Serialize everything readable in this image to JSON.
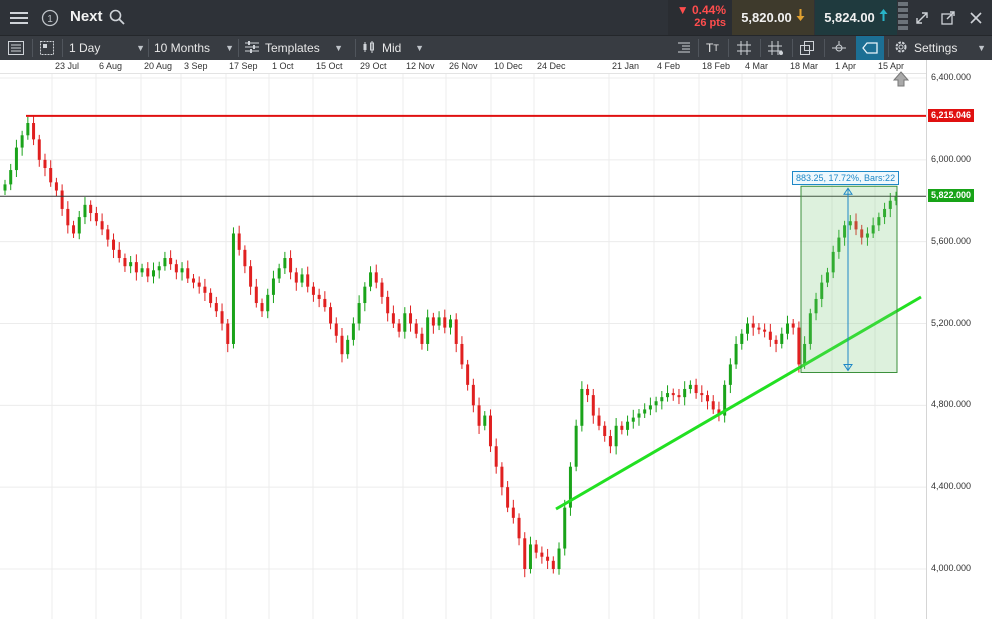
{
  "header": {
    "instrument": "Next",
    "change_pct": "0.44%",
    "change_pts": "26 pts",
    "sell_price": "5,820.00",
    "buy_price": "5,824.00",
    "icons": [
      "menu-icon",
      "history-icon",
      "search-icon",
      "sell-down-arrow-icon",
      "buy-up-arrow-icon",
      "expand-icon",
      "popout-icon",
      "close-icon"
    ]
  },
  "toolbar": {
    "interval": "1 Day",
    "range": "10 Months",
    "templates": "Templates",
    "price_type": "Mid",
    "settings": "Settings"
  },
  "chart_data": {
    "type": "candlestick",
    "x_labels": [
      "23 Jul",
      "6 Aug",
      "20 Aug",
      "3 Sep",
      "17 Sep",
      "1 Oct",
      "15 Oct",
      "29 Oct",
      "12 Nov",
      "26 Nov",
      "10 Dec",
      "24 Dec",
      "21 Jan",
      "4 Feb",
      "18 Feb",
      "4 Mar",
      "18 Mar",
      "1 Apr",
      "15 Apr"
    ],
    "y_ticks": [
      "6,400.000",
      "6,000.000",
      "5,600.000",
      "5,200.000",
      "4,800.000",
      "4,400.000",
      "4,000.000"
    ],
    "ylim": [
      3980,
      6400
    ],
    "horizontal_line": {
      "value": 6215.046,
      "label": "6,215.046",
      "color": "#e01010"
    },
    "current_price": {
      "value": 5822.0,
      "label": "5,822.000",
      "color": "#17a317"
    },
    "trendline": {
      "color": "#22e022"
    },
    "measure": {
      "label": "883.25, 17.72%, Bars:22",
      "from": 4980,
      "to": 5822
    },
    "up_color": "#1aa31a",
    "down_color": "#e02020",
    "closes": [
      5880,
      5950,
      6060,
      6120,
      6180,
      6100,
      6000,
      5960,
      5890,
      5850,
      5760,
      5680,
      5640,
      5720,
      5780,
      5740,
      5700,
      5660,
      5610,
      5560,
      5520,
      5480,
      5500,
      5450,
      5470,
      5430,
      5460,
      5480,
      5520,
      5490,
      5450,
      5470,
      5420,
      5400,
      5380,
      5350,
      5300,
      5260,
      5200,
      5100,
      5640,
      5560,
      5480,
      5380,
      5300,
      5260,
      5340,
      5420,
      5470,
      5520,
      5450,
      5400,
      5440,
      5380,
      5340,
      5320,
      5280,
      5200,
      5140,
      5050,
      5120,
      5200,
      5300,
      5380,
      5450,
      5400,
      5330,
      5250,
      5200,
      5160,
      5250,
      5200,
      5150,
      5100,
      5230,
      5190,
      5230,
      5180,
      5220,
      5100,
      5000,
      4900,
      4800,
      4700,
      4750,
      4600,
      4500,
      4400,
      4300,
      4250,
      4150,
      4000,
      4120,
      4080,
      4060,
      4040,
      4000,
      4100,
      4300,
      4500,
      4700,
      4880,
      4850,
      4750,
      4700,
      4650,
      4600,
      4700,
      4680,
      4720,
      4740,
      4760,
      4780,
      4800,
      4820,
      4840,
      4860,
      4850,
      4840,
      4880,
      4900,
      4860,
      4850,
      4820,
      4780,
      4750,
      4900,
      5000,
      5100,
      5150,
      5200,
      5180,
      5170,
      5160,
      5120,
      5100,
      5150,
      5200,
      5180,
      5000,
      5100,
      5250,
      5320,
      5400,
      5450,
      5550,
      5620,
      5680,
      5700,
      5660,
      5620,
      5640,
      5680,
      5720,
      5760,
      5800,
      5822
    ]
  }
}
